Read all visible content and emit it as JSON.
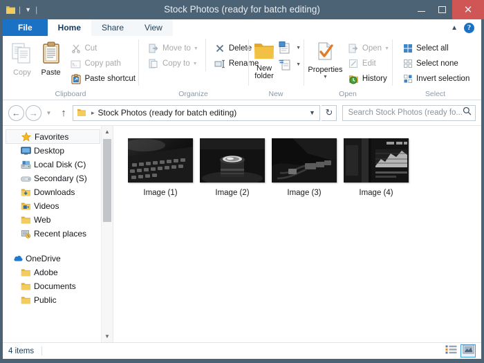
{
  "window": {
    "title": "Stock Photos (ready for batch editing)",
    "quick_access": {
      "folder_icon": "folder-icon",
      "dropdown_icon": "chevron-down-icon"
    },
    "controls": {
      "minimize": "minimize-icon",
      "maximize": "maximize-icon",
      "close": "close-icon",
      "close_color": "#cf5655"
    }
  },
  "ribbon": {
    "tabs": [
      {
        "label": "File",
        "state": "file"
      },
      {
        "label": "Home",
        "state": "active"
      },
      {
        "label": "Share",
        "state": "normal"
      },
      {
        "label": "View",
        "state": "normal"
      }
    ],
    "collapse_icon": "chevron-up-icon",
    "help_icon": "help-icon",
    "help_label": "?",
    "groups": [
      {
        "label": "Clipboard",
        "big_buttons": [
          {
            "label": "Copy",
            "icon": "copy-icon",
            "disabled": true
          },
          {
            "label": "Paste",
            "icon": "paste-icon",
            "disabled": false
          }
        ],
        "small_buttons": [
          {
            "label": "Cut",
            "icon": "scissors-icon",
            "disabled": true
          },
          {
            "label": "Copy path",
            "icon": "copy-path-icon",
            "disabled": true
          },
          {
            "label": "Paste shortcut",
            "icon": "paste-shortcut-icon",
            "disabled": false
          }
        ]
      },
      {
        "label": "Organize",
        "small_buttons": [
          {
            "label": "Move to",
            "icon": "move-to-icon",
            "disabled": true,
            "caret": true
          },
          {
            "label": "Copy to",
            "icon": "copy-to-icon",
            "disabled": true,
            "caret": true
          },
          {
            "label": "Delete",
            "icon": "delete-icon",
            "disabled": false,
            "caret": true
          },
          {
            "label": "Rename",
            "icon": "rename-icon",
            "disabled": false,
            "caret": false
          }
        ]
      },
      {
        "label": "New",
        "big_buttons": [
          {
            "label": "New\nfolder",
            "label_line1": "New",
            "label_line2": "folder",
            "icon": "new-folder-icon",
            "disabled": false
          }
        ],
        "stacked_buttons": [
          {
            "icon": "new-item-icon",
            "caret": true
          },
          {
            "icon": "easy-access-icon",
            "caret": true
          }
        ]
      },
      {
        "label": "Open",
        "big_buttons": [
          {
            "label": "Properties",
            "icon": "properties-icon",
            "disabled": false,
            "caret": true
          }
        ],
        "small_buttons": [
          {
            "label": "Open",
            "icon": "open-icon",
            "disabled": true,
            "caret": true
          },
          {
            "label": "Edit",
            "icon": "edit-icon",
            "disabled": true,
            "caret": false
          },
          {
            "label": "History",
            "icon": "history-icon",
            "disabled": false,
            "caret": false
          }
        ]
      },
      {
        "label": "Select",
        "small_buttons": [
          {
            "label": "Select all",
            "icon": "select-all-icon",
            "disabled": false
          },
          {
            "label": "Select none",
            "icon": "select-none-icon",
            "disabled": false
          },
          {
            "label": "Invert selection",
            "icon": "invert-selection-icon",
            "disabled": false
          }
        ]
      }
    ]
  },
  "addressbar": {
    "back_icon": "back-arrow-icon",
    "forward_icon": "forward-arrow-icon",
    "recent_icon": "chevron-down-icon",
    "up_icon": "up-arrow-icon",
    "folder_icon": "folder-icon",
    "crumb": "Stock Photos (ready for batch editing)",
    "crumb_separator": "▸",
    "dropdown_icon": "chevron-down-icon",
    "refresh_icon": "refresh-icon",
    "search": {
      "placeholder": "Search Stock Photos (ready fo...",
      "value": "",
      "icon": "search-icon"
    }
  },
  "navpane": {
    "sections": [
      {
        "root": {
          "label": "Favorites",
          "icon": "star-icon",
          "selected": true
        },
        "items": [
          {
            "label": "Desktop",
            "icon": "desktop-icon"
          },
          {
            "label": "Local Disk (C)",
            "icon": "harddisk-icon"
          },
          {
            "label": "Secondary (S)",
            "icon": "drive-icon"
          },
          {
            "label": "Downloads",
            "icon": "downloads-folder-icon"
          },
          {
            "label": "Videos",
            "icon": "videos-folder-icon"
          },
          {
            "label": "Web",
            "icon": "folder-icon"
          },
          {
            "label": "Recent places",
            "icon": "recent-places-icon"
          }
        ]
      },
      {
        "root": {
          "label": "OneDrive",
          "icon": "onedrive-icon",
          "selected": false
        },
        "items": [
          {
            "label": "Adobe",
            "icon": "folder-icon"
          },
          {
            "label": "Documents",
            "icon": "folder-icon"
          },
          {
            "label": "Public",
            "icon": "folder-icon"
          }
        ]
      }
    ],
    "scrollbar": {
      "up_icon": "chevron-up-icon",
      "down_icon": "chevron-down-icon"
    }
  },
  "files": {
    "items": [
      {
        "label": "Image (1)",
        "thumb": "keyboard-photo"
      },
      {
        "label": "Image (2)",
        "thumb": "camera-lens-photo"
      },
      {
        "label": "Image (3)",
        "thumb": "cables-photo"
      },
      {
        "label": "Image (4)",
        "thumb": "monitor-photo"
      }
    ]
  },
  "statusbar": {
    "count": "4 items",
    "views": [
      {
        "icon": "details-view-icon",
        "active": false
      },
      {
        "icon": "large-icons-view-icon",
        "active": true
      }
    ]
  },
  "colors": {
    "frame": "#4c6275",
    "file_tab": "#1b72c4",
    "accent": "#3e9bdd",
    "close": "#cf5655"
  }
}
